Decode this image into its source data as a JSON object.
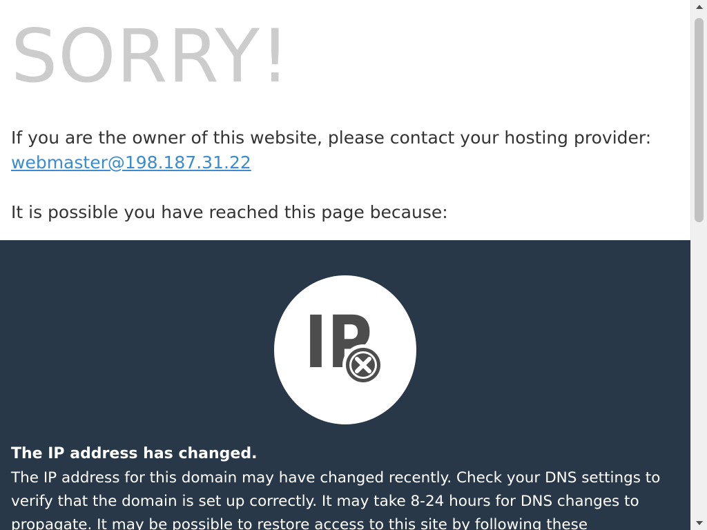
{
  "header": {
    "title": "SORRY!"
  },
  "intro": {
    "owner_text": "If you are the owner of this website, please contact your hosting provider:",
    "email": "webmaster@198.187.31.22",
    "reason_intro": "It is possible you have reached this page because:"
  },
  "reason": {
    "icon": "ip-error-icon",
    "icon_letters": "IP",
    "title": "The IP address has changed.",
    "description": "The IP address for this domain may have changed recently. Check your DNS settings to verify that the domain is set up correctly. It may take 8-24 hours for DNS changes to propagate. It may be possible to restore access to this site by following these"
  },
  "colors": {
    "title_gray": "#cccccc",
    "link_blue": "#3b8bd1",
    "panel_dark": "#283848",
    "icon_gray": "#4d4d4d"
  }
}
